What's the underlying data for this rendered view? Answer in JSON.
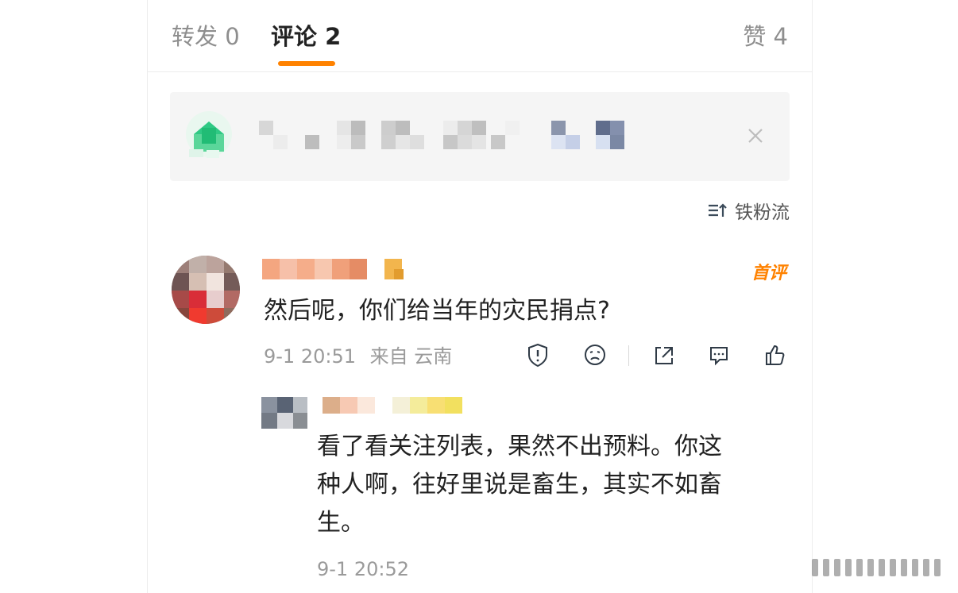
{
  "tabs": {
    "repost": "转发 0",
    "comment": "评论 2",
    "like": "赞 4"
  },
  "banner": {
    "icon": "app-icon",
    "close_icon": "close-icon"
  },
  "sort": {
    "label": "铁粉流",
    "icon": "sort-icon"
  },
  "comment": {
    "badge": "首评",
    "text": "然后呢，你们给当年的灾民捐点?",
    "time": "9-1 20:51",
    "source": "来自 云南"
  },
  "actions": {
    "icons": [
      "info-icon",
      "sad-icon",
      "share-icon",
      "comment-icon",
      "like-icon"
    ]
  },
  "reply": {
    "lines": [
      "看了看关注列表，果然不出预料。你这",
      "种人啊，往好里说是畜生，其实不如畜",
      "生。"
    ],
    "time": "9-1 20:52"
  },
  "colors": {
    "accent": "#ff8200",
    "text_primary": "#222222",
    "text_secondary": "#9a9a9a",
    "banner_bg": "#f5f5f5"
  }
}
